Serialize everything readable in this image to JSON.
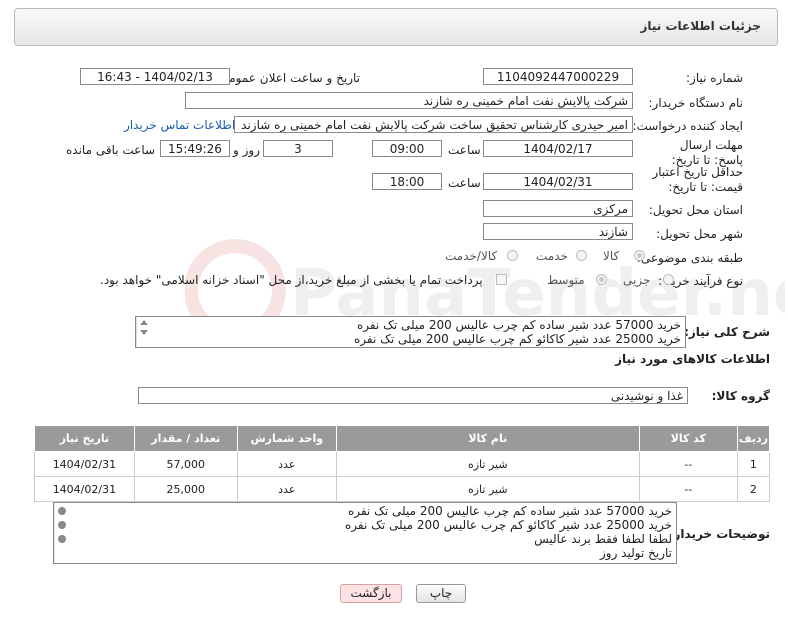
{
  "header": {
    "title": "جزئیات اطلاعات نیاز"
  },
  "fields": {
    "need_number_label": "شماره نیاز:",
    "need_number": "1104092447000229",
    "announce_label": "تاریخ و ساعت اعلان عمومی:",
    "announce_value": "1404/02/13 - 16:43",
    "buyer_org_label": "نام دستگاه خریدار:",
    "buyer_org": "شرکت پالایش نفت امام خمینی  ره  شازند",
    "creator_label": "ایجاد کننده درخواست:",
    "creator": "امیر  حیدری کارشناس تحقیق ساخت شرکت پالایش نفت امام خمینی  ره  شازند",
    "contact_link": "اطلاعات تماس خریدار",
    "reply_deadline_label": "مهلت ارسال پاسخ: تا تاریخ:",
    "reply_date": "1404/02/17",
    "time_label": "ساعت",
    "reply_time": "09:00",
    "days_value": "3",
    "days_label": "روز و",
    "remaining_time": "15:49:26",
    "remaining_label": "ساعت باقی مانده",
    "price_validity_label": "حداقل تاریخ اعتبار قیمت: تا تاریخ:",
    "price_date": "1404/02/31",
    "price_time": "18:00",
    "province_label": "استان محل تحویل:",
    "province": "مرکزی",
    "city_label": "شهر محل تحویل:",
    "city": "شازند",
    "category_label": "طبقه بندی موضوعی:",
    "category_options": [
      "کالا",
      "خدمت",
      "کالا/خدمت"
    ],
    "process_label": "نوع فرآیند خرید :",
    "process_options": [
      "جزیی",
      "متوسط"
    ],
    "payment_note": "پرداخت تمام یا بخشی از مبلغ خرید،از محل \"اسناد خزانه اسلامی\" خواهد بود."
  },
  "description": {
    "label": "شرح کلی نیاز:",
    "lines": [
      "خرید 57000 عدد شیر ساده کم چرب عالیس 200 میلی تک نفره",
      "خرید 25000 عدد شیر کاکائو کم چرب عالیس 200 میلی تک نفره"
    ]
  },
  "goods": {
    "section_title": "اطلاعات کالاهای مورد نیاز",
    "group_label": "گروه کالا:",
    "group_value": "غذا و نوشیدنی",
    "columns": [
      "ردیف",
      "کد کالا",
      "نام کالا",
      "واحد شمارش",
      "تعداد / مقدار",
      "تاریخ نیاز"
    ],
    "rows": [
      {
        "idx": "1",
        "code": "--",
        "name": "شیر تازه",
        "unit": "عدد",
        "qty": "57,000",
        "date": "1404/02/31"
      },
      {
        "idx": "2",
        "code": "--",
        "name": "شیر تازه",
        "unit": "عدد",
        "qty": "25,000",
        "date": "1404/02/31"
      }
    ]
  },
  "buyer_notes": {
    "label": "توضیحات خریدار:",
    "lines": [
      "خرید 57000 عدد شیر ساده کم چرب عالیس 200 میلی تک نفره",
      "خرید 25000 عدد شیر کاکائو کم چرب عالیس 200 میلی تک نفره",
      "لطفا لطفا فقط برند عالیس",
      "تاریخ تولید روز"
    ]
  },
  "buttons": {
    "print": "چاپ",
    "back": "بازگشت"
  },
  "watermark": {
    "text": "PanaTender.net"
  }
}
